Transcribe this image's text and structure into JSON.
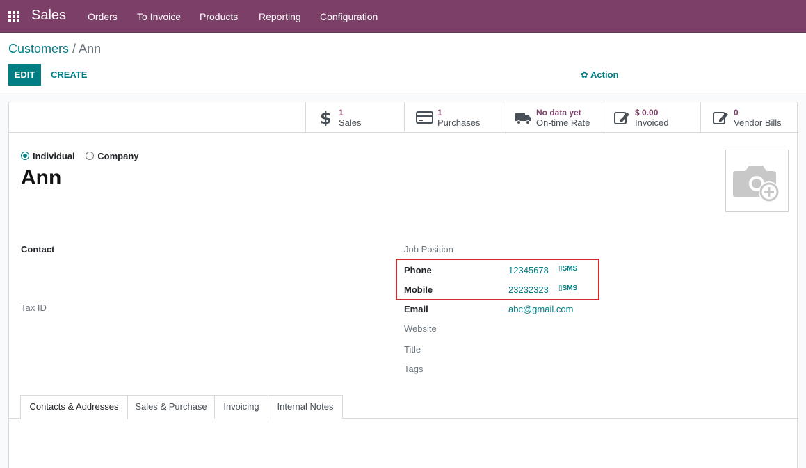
{
  "navbar": {
    "app_name": "Sales",
    "menu": [
      "Orders",
      "To Invoice",
      "Products",
      "Reporting",
      "Configuration"
    ]
  },
  "breadcrumb": {
    "parent": "Customers",
    "separator": "/",
    "current": "Ann"
  },
  "buttons": {
    "edit": "EDIT",
    "create": "CREATE",
    "action": "Action"
  },
  "smart_buttons": [
    {
      "value": "1",
      "label": "Sales",
      "icon": "dollar-icon"
    },
    {
      "value": "1",
      "label": "Purchases",
      "icon": "credit-card-icon"
    },
    {
      "value": "No data yet",
      "label": "On-time Rate",
      "icon": "truck-icon"
    },
    {
      "value": "$ 0.00",
      "label": "Invoiced",
      "icon": "edit-icon"
    },
    {
      "value": "0",
      "label": "Vendor Bills",
      "icon": "edit-icon"
    }
  ],
  "company_type": {
    "individual": "Individual",
    "company": "Company",
    "selected": "Individual"
  },
  "partner": {
    "name": "Ann"
  },
  "left_fields": {
    "contact_label": "Contact",
    "tax_id_label": "Tax ID"
  },
  "right_fields": {
    "job_position_label": "Job Position",
    "phone_label": "Phone",
    "phone_value": "12345678",
    "mobile_label": "Mobile",
    "mobile_value": "23232323",
    "sms_label": "SMS",
    "email_label": "Email",
    "email_value": "abc@gmail.com",
    "website_label": "Website",
    "title_label": "Title",
    "tags_label": "Tags"
  },
  "tabs": [
    "Contacts & Addresses",
    "Sales & Purchase",
    "Invoicing",
    "Internal Notes"
  ],
  "colors": {
    "navbar": "#7c4068",
    "primary": "#017e84",
    "highlight": "#d42a2a"
  }
}
